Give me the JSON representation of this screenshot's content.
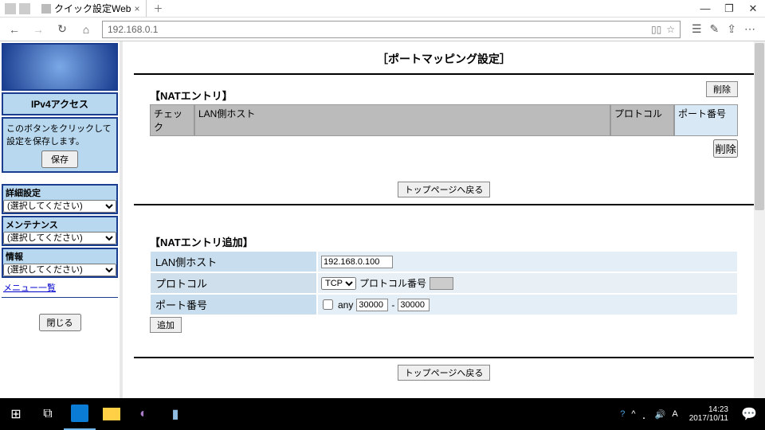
{
  "browser": {
    "tab_title": "クイック設定Web",
    "url": "192.168.0.1"
  },
  "sidebar": {
    "ipv4_label": "IPv4アクセス",
    "save_desc": "このボタンをクリックして設定を保存します。",
    "save_btn": "保存",
    "menus": [
      {
        "label": "詳細設定",
        "placeholder": "(選択してください)"
      },
      {
        "label": "メンテナンス",
        "placeholder": "(選択してください)"
      },
      {
        "label": "情報",
        "placeholder": "(選択してください)"
      }
    ],
    "menu_link": "メニュー一覧",
    "close_btn": "閉じる"
  },
  "main": {
    "page_title": "［ポートマッピング設定］",
    "nat_entry": {
      "heading": "【NATエントリ】",
      "delete_btn": "削除",
      "cols": {
        "check": "チェック",
        "lan": "LAN側ホスト",
        "proto": "プロトコル",
        "port": "ポート番号"
      }
    },
    "back_top_btn": "トップページへ戻る",
    "nat_add": {
      "heading": "【NATエントリ追加】",
      "rows": {
        "lan_host": {
          "label": "LAN側ホスト",
          "value": "192.168.0.100"
        },
        "protocol": {
          "label": "プロトコル",
          "select": "TCP",
          "num_label": "プロトコル番号",
          "num_value": ""
        },
        "port": {
          "label": "ポート番号",
          "any_label": "any",
          "from": "30000",
          "dash": "-",
          "to": "30000"
        }
      },
      "add_btn": "追加"
    }
  },
  "taskbar": {
    "time": "14:23",
    "date": "2017/10/11"
  }
}
